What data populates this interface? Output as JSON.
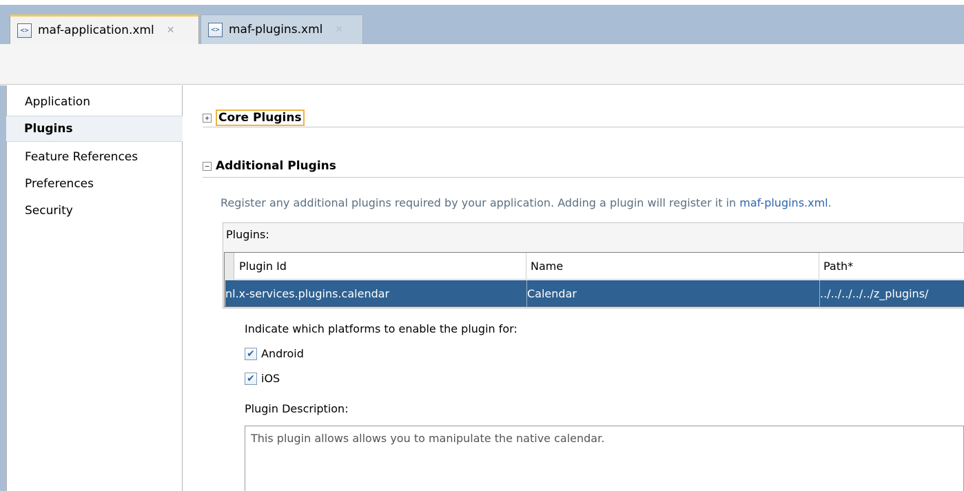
{
  "tabs": [
    {
      "label": "maf-application.xml",
      "icon": "xml-file-icon",
      "active": true
    },
    {
      "label": "maf-plugins.xml",
      "icon": "xml-file-icon",
      "active": false
    }
  ],
  "nav": {
    "items": [
      {
        "label": "Application",
        "selected": false
      },
      {
        "label": "Plugins",
        "selected": true
      },
      {
        "label": "Feature References",
        "selected": false
      },
      {
        "label": "Preferences",
        "selected": false
      },
      {
        "label": "Security",
        "selected": false
      }
    ]
  },
  "sections": {
    "core": {
      "title": "Core Plugins",
      "expanded": false
    },
    "additional": {
      "title": "Additional Plugins",
      "expanded": true,
      "description_prefix": "Register any additional plugins required by your application. Adding a plugin will register it in ",
      "description_link": "maf-plugins.xml",
      "description_suffix": "."
    }
  },
  "plugins_table": {
    "label": "Plugins:",
    "columns": [
      "Plugin Id",
      "Name",
      "Path*"
    ],
    "rows": [
      {
        "id": "nl.x-services.plugins.calendar",
        "name": "Calendar",
        "path": "../../../../../z_plugins/"
      }
    ]
  },
  "platforms": {
    "label": "Indicate which platforms to enable the plugin for:",
    "android": {
      "label": "Android",
      "checked": true
    },
    "ios": {
      "label": "iOS",
      "checked": true
    }
  },
  "plugin_description": {
    "label": "Plugin Description:",
    "value": "This plugin allows allows you to manipulate the native calendar."
  },
  "colors": {
    "selection_row": "#2f6192",
    "tab_strip": "#a9bed4",
    "active_tab_accent": "#f2c85b",
    "link": "#2f63b0"
  }
}
